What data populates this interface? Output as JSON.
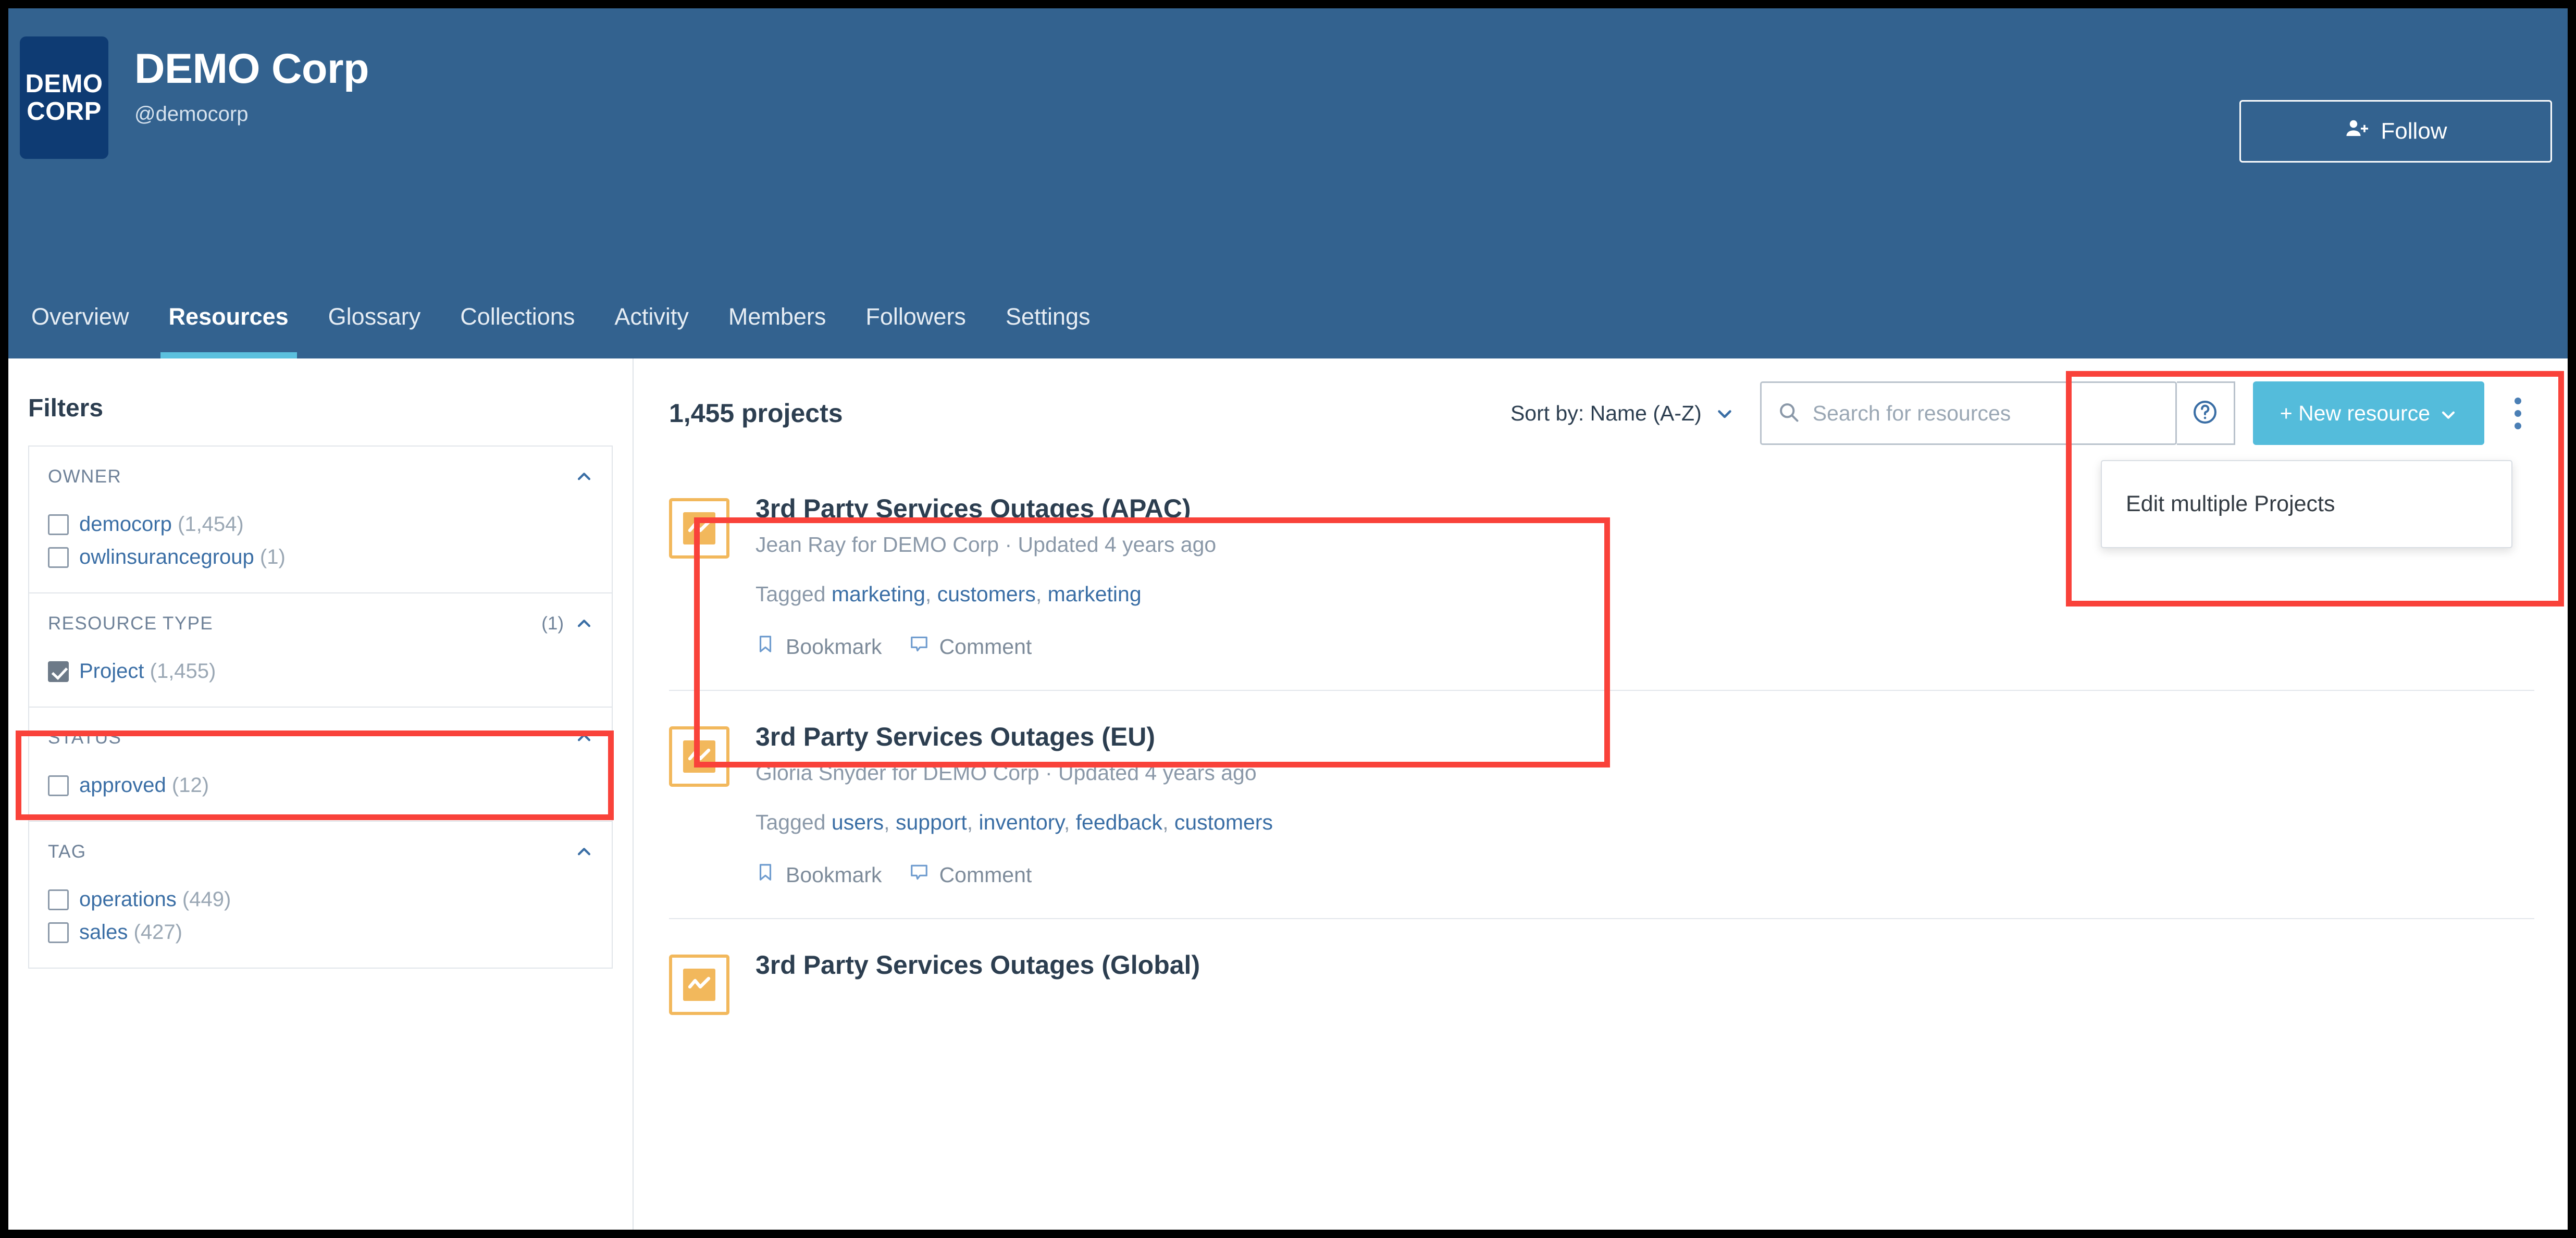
{
  "org": {
    "logo_line1": "DEMO",
    "logo_line2": "CORP",
    "name": "DEMO Corp",
    "handle": "@democorp",
    "follow_label": "Follow"
  },
  "nav": {
    "tabs": [
      {
        "label": "Overview",
        "active": false
      },
      {
        "label": "Resources",
        "active": true
      },
      {
        "label": "Glossary",
        "active": false
      },
      {
        "label": "Collections",
        "active": false
      },
      {
        "label": "Activity",
        "active": false
      },
      {
        "label": "Members",
        "active": false
      },
      {
        "label": "Followers",
        "active": false
      },
      {
        "label": "Settings",
        "active": false
      }
    ]
  },
  "sidebar": {
    "title": "Filters",
    "groups": [
      {
        "label": "OWNER",
        "count": "",
        "items": [
          {
            "label": "democorp",
            "count": "(1,454)",
            "checked": false
          },
          {
            "label": "owlinsurancegroup",
            "count": "(1)",
            "checked": false
          }
        ]
      },
      {
        "label": "RESOURCE TYPE",
        "count": "(1)",
        "items": [
          {
            "label": "Project",
            "count": "(1,455)",
            "checked": true
          }
        ]
      },
      {
        "label": "STATUS",
        "count": "",
        "items": [
          {
            "label": "approved",
            "count": "(12)",
            "checked": false
          }
        ]
      },
      {
        "label": "TAG",
        "count": "",
        "items": [
          {
            "label": "operations",
            "count": "(449)",
            "checked": false
          },
          {
            "label": "sales",
            "count": "(427)",
            "checked": false
          }
        ]
      }
    ]
  },
  "toolbar": {
    "count_label": "1,455 projects",
    "sort_label": "Sort by: Name (A-Z)",
    "search_placeholder": "Search for resources",
    "search_value": "",
    "new_resource_label": "+ New resource",
    "dropdown": {
      "items": [
        {
          "label": "Edit multiple Projects"
        }
      ]
    }
  },
  "cards": [
    {
      "title": "3rd Party Services Outages (APAC)",
      "subtitle": "Jean Ray for DEMO Corp  ·  Updated 4 years ago",
      "tagged_prefix": "Tagged ",
      "tags": [
        "marketing",
        "customers",
        "marketing"
      ],
      "bookmark_label": "Bookmark",
      "comment_label": "Comment"
    },
    {
      "title": "3rd Party Services Outages (EU)",
      "subtitle": "Gloria Snyder for DEMO Corp  ·  Updated 4 years ago",
      "tagged_prefix": "Tagged ",
      "tags": [
        "users",
        "support",
        "inventory",
        "feedback",
        "customers"
      ],
      "bookmark_label": "Bookmark",
      "comment_label": "Comment"
    },
    {
      "title": "3rd Party Services Outages (Global)",
      "subtitle": "",
      "tagged_prefix": "",
      "tags": [],
      "bookmark_label": "",
      "comment_label": ""
    }
  ],
  "colors": {
    "header_blue": "#33628f",
    "logo_navy": "#0e3b73",
    "accent_cyan": "#54bcdb",
    "link_blue": "#3a6ea5",
    "highlight_red": "#f9423a",
    "icon_orange": "#f2b85c"
  }
}
